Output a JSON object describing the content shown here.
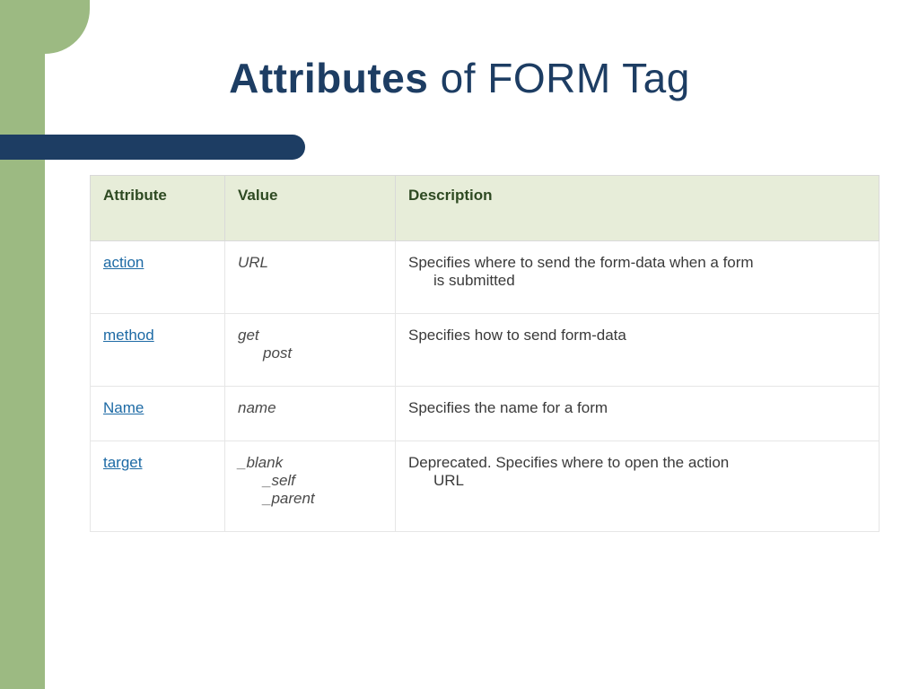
{
  "title": {
    "bold": "Attributes",
    "rest": " of FORM Tag"
  },
  "table": {
    "headers": {
      "attribute": "Attribute",
      "value": "Value",
      "description": "Description"
    },
    "rows": [
      {
        "attr": "action",
        "vals": [
          "URL"
        ],
        "desc_first": "Specifies where to send the form-data when a form",
        "desc_rest": "is submitted"
      },
      {
        "attr": "method",
        "vals": [
          "get",
          "post"
        ],
        "desc_first": "Specifies how to send form-data",
        "desc_rest": ""
      },
      {
        "attr": "Name",
        "vals": [
          "name"
        ],
        "desc_first": "Specifies the name for a form",
        "desc_rest": ""
      },
      {
        "attr": "target",
        "vals": [
          "_blank",
          "_self",
          "_parent"
        ],
        "desc_first": "Deprecated. Specifies where to open the action",
        "desc_rest": "URL"
      }
    ]
  }
}
